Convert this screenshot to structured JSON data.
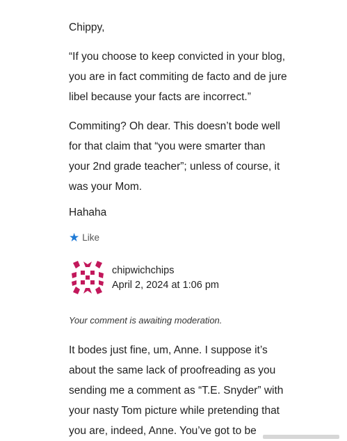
{
  "comment1": {
    "greeting": "Chippy,",
    "quote_lines": [
      "“If you choose to keep convicted in your blog,",
      "you are in fact commiting de facto and de jure",
      "libel because your facts are incorrect.”"
    ],
    "reply_lines": [
      "Commiting? Oh dear. This doesn’t bode well",
      "for that claim that “you were smarter than",
      "your 2nd grade teacher”; unless of course, it",
      "was your Mom."
    ],
    "laugh": "Hahaha",
    "like_label": "Like"
  },
  "comment2": {
    "author": "chipwichchips",
    "date": "April 2, 2024 at 1:06 pm",
    "moderation_note": "Your comment is awaiting moderation.",
    "body_lines": [
      "It bodes just fine, um, Anne. I suppose it’s",
      "about the same lack of proofreading as you",
      "sending me a comment as “T.E. Snyder” with",
      "your nasty Tom picture while pretending that",
      "you are, indeed, Anne. You’ve got to be"
    ]
  },
  "colors": {
    "like_star": "#1f7ad6",
    "avatar_pattern": "#c2185b"
  }
}
